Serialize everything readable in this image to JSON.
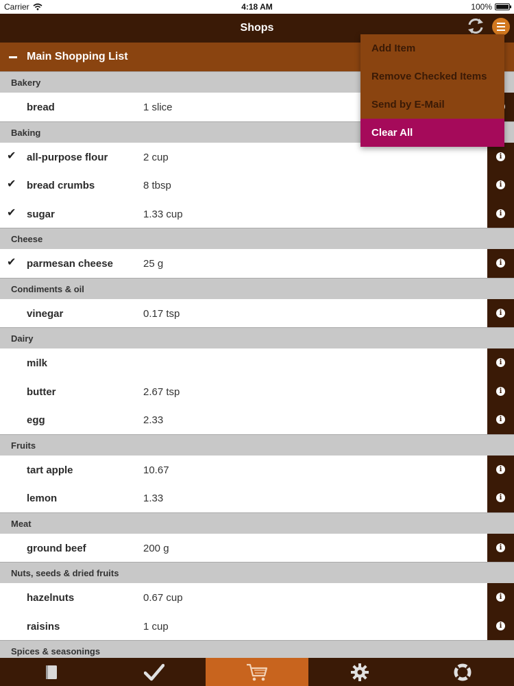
{
  "status_bar": {
    "carrier": "Carrier",
    "time": "4:18 AM",
    "battery": "100%"
  },
  "nav": {
    "title": "Shops"
  },
  "list_header": {
    "title": "Main Shopping List"
  },
  "dropdown": {
    "items": [
      {
        "label": "Add Item"
      },
      {
        "label": "Remove Checked Items"
      },
      {
        "label": "Send by E-Mail"
      },
      {
        "label": "Clear All"
      }
    ]
  },
  "categories": [
    {
      "name": "Bakery",
      "items": [
        {
          "name": "bread",
          "qty": "1 slice",
          "checked": false
        }
      ]
    },
    {
      "name": "Baking",
      "items": [
        {
          "name": "all-purpose flour",
          "qty": "2 cup",
          "checked": true
        },
        {
          "name": "bread crumbs",
          "qty": "8 tbsp",
          "checked": true
        },
        {
          "name": "sugar",
          "qty": "1.33 cup",
          "checked": true
        }
      ]
    },
    {
      "name": "Cheese",
      "items": [
        {
          "name": "parmesan cheese",
          "qty": "25 g",
          "checked": true
        }
      ]
    },
    {
      "name": "Condiments & oil",
      "items": [
        {
          "name": "vinegar",
          "qty": "0.17 tsp",
          "checked": false
        }
      ]
    },
    {
      "name": "Dairy",
      "items": [
        {
          "name": "milk",
          "qty": "",
          "checked": false
        },
        {
          "name": "butter",
          "qty": "2.67 tsp",
          "checked": false
        },
        {
          "name": "egg",
          "qty": "2.33",
          "checked": false
        }
      ]
    },
    {
      "name": "Fruits",
      "items": [
        {
          "name": "tart apple",
          "qty": "10.67",
          "checked": false
        },
        {
          "name": "lemon",
          "qty": "1.33",
          "checked": false
        }
      ]
    },
    {
      "name": "Meat",
      "items": [
        {
          "name": "ground beef",
          "qty": "200 g",
          "checked": false
        }
      ]
    },
    {
      "name": "Nuts, seeds & dried fruits",
      "items": [
        {
          "name": "hazelnuts",
          "qty": "0.67 cup",
          "checked": false
        },
        {
          "name": "raisins",
          "qty": "1 cup",
          "checked": false
        }
      ]
    },
    {
      "name": "Spices & seasonings",
      "items": []
    }
  ],
  "tab_bar": {
    "tabs": [
      {
        "icon": "book-icon",
        "selected": false
      },
      {
        "icon": "checkmark-icon",
        "selected": false
      },
      {
        "icon": "shopping-cart-icon",
        "selected": true
      },
      {
        "icon": "gear-icon",
        "selected": false
      },
      {
        "icon": "lifebuoy-icon",
        "selected": false
      }
    ]
  },
  "colors": {
    "nav_bg": "#3a1a06",
    "header_bg": "#8a4410",
    "accent": "#c8641e",
    "menu_active": "#a50a5a",
    "category_bg": "#c8c8c8"
  }
}
